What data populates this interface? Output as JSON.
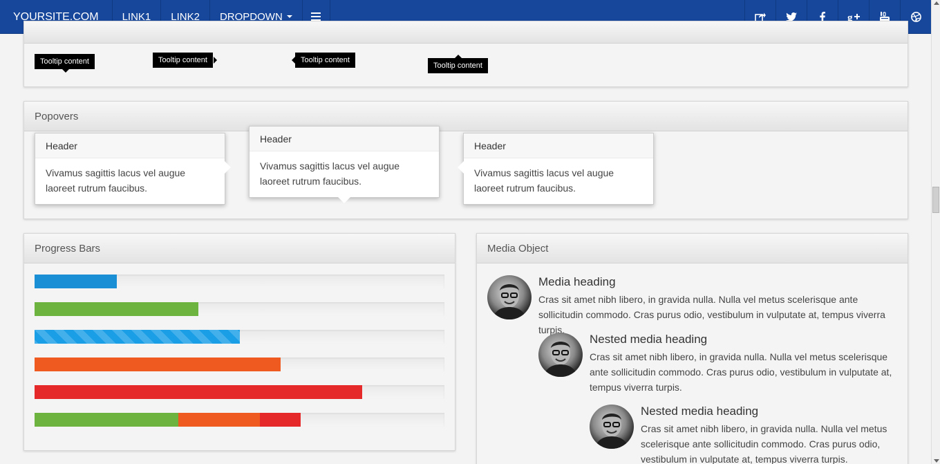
{
  "navbar": {
    "brand": "YOURSITE.COM",
    "links": [
      "LINK1",
      "LINK2"
    ],
    "dropdown": "DROPDOWN",
    "menu_icon": "hamburger-icon",
    "social_icons": [
      "share-icon",
      "twitter-icon",
      "facebook-icon",
      "google-plus-icon",
      "youtube-icon",
      "dribbble-icon"
    ],
    "color": "#17479b"
  },
  "tooltips": {
    "items": [
      "Tooltip content",
      "Tooltip content",
      "Tooltip content",
      "Tooltip content"
    ]
  },
  "popovers": {
    "title": "Popovers",
    "items": [
      {
        "header": "Header",
        "body": "Vivamus sagittis lacus vel augue laoreet rutrum faucibus."
      },
      {
        "header": "Header",
        "body": "Vivamus sagittis lacus vel augue laoreet rutrum faucibus."
      },
      {
        "header": "Header",
        "body": "Vivamus sagittis lacus vel augue laoreet rutrum faucibus."
      }
    ]
  },
  "progress": {
    "title": "Progress Bars",
    "bars": [
      {
        "segments": [
          {
            "percent": 20,
            "color": "#1a8fd6",
            "striped": false
          }
        ]
      },
      {
        "segments": [
          {
            "percent": 40,
            "color": "#6db33f",
            "striped": false
          }
        ]
      },
      {
        "segments": [
          {
            "percent": 50,
            "color": "#1a9ee6",
            "striped": true
          }
        ]
      },
      {
        "segments": [
          {
            "percent": 60,
            "color": "#ee5a1f",
            "striped": false
          }
        ]
      },
      {
        "segments": [
          {
            "percent": 80,
            "color": "#e5282a",
            "striped": false
          }
        ]
      },
      {
        "segments": [
          {
            "percent": 35,
            "color": "#6db33f",
            "striped": false
          },
          {
            "percent": 20,
            "color": "#ee5a1f",
            "striped": false
          },
          {
            "percent": 10,
            "color": "#e5282a",
            "striped": false
          }
        ]
      }
    ]
  },
  "media": {
    "title": "Media Object",
    "items": [
      {
        "heading": "Media heading",
        "text": "Cras sit amet nibh libero, in gravida nulla. Nulla vel metus scelerisque ante sollicitudin commodo. Cras purus odio, vestibulum in vulputate at, tempus viverra turpis."
      },
      {
        "heading": "Nested media heading",
        "text": "Cras sit amet nibh libero, in gravida nulla. Nulla vel metus scelerisque ante sollicitudin commodo. Cras purus odio, vestibulum in vulputate at, tempus viverra turpis."
      },
      {
        "heading": "Nested media heading",
        "text": "Cras sit amet nibh libero, in gravida nulla. Nulla vel metus scelerisque ante sollicitudin commodo. Cras purus odio, vestibulum in vulputate at, tempus viverra turpis."
      }
    ]
  }
}
